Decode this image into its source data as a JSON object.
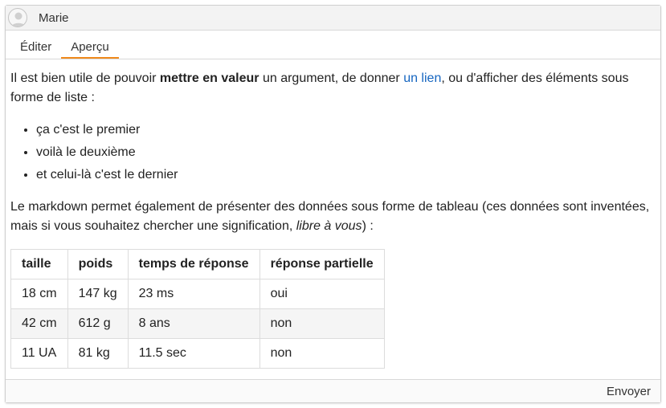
{
  "header": {
    "username": "Marie",
    "avatar_icon": "user-avatar-icon"
  },
  "tabs": [
    {
      "label": "Éditer",
      "active": false
    },
    {
      "label": "Aperçu",
      "active": true
    }
  ],
  "content": {
    "para1_prefix": "Il est bien utile de pouvoir ",
    "para1_bold": "mettre en valeur",
    "para1_mid": " un argument, de donner ",
    "para1_link": "un lien",
    "para1_suffix": ", ou d'afficher des éléments sous forme de liste :",
    "list": [
      "ça c'est le premier",
      "voilà le deuxième",
      "et celui-là c'est le dernier"
    ],
    "para2_prefix": "Le markdown permet également de présenter des données sous forme de tableau (ces données sont inventées, mais si vous souhaitez chercher une signification, ",
    "para2_italic": "libre à vous",
    "para2_suffix": ") :",
    "table": {
      "headers": [
        "taille",
        "poids",
        "temps de réponse",
        "réponse partielle"
      ],
      "rows": [
        [
          "18 cm",
          "147 kg",
          "23 ms",
          "oui"
        ],
        [
          "42 cm",
          "612 g",
          "8 ans",
          "non"
        ],
        [
          "11 UA",
          "81 kg",
          "11.5 sec",
          "non"
        ]
      ]
    }
  },
  "footer": {
    "send_label": "Envoyer"
  },
  "colors": {
    "accent": "#f08a1c",
    "link": "#1565c0"
  }
}
